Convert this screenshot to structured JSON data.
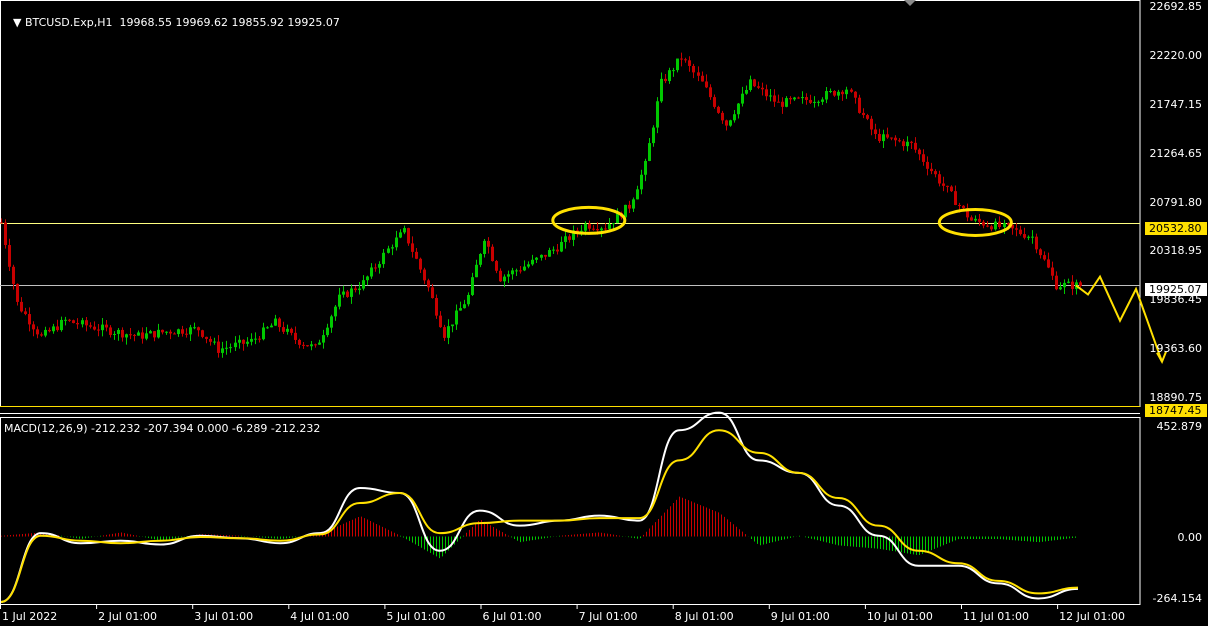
{
  "header": {
    "symbol": "BTCUSD.Exp,H1",
    "ohlc": "19968.55 19969.62 19855.92 19925.07",
    "indicator": "MACD(12,26,9) -212.232 -207.394 0.000 -6.289 -212.232"
  },
  "price_axis": {
    "ticks": [
      "22692.85",
      "22220.00",
      "21747.15",
      "21264.65",
      "20791.80",
      "20318.95",
      "19836.45",
      "19363.60",
      "18890.75"
    ],
    "level_labels": {
      "support_line": "20532.80",
      "current_price": "19925.07",
      "low_line": "18747.45"
    }
  },
  "macd_axis": {
    "ticks": [
      "452.879",
      "0.00",
      "-264.154"
    ]
  },
  "time_axis": {
    "ticks": [
      "1 Jul 2022",
      "2 Jul 01:00",
      "3 Jul 01:00",
      "4 Jul 01:00",
      "5 Jul 01:00",
      "6 Jul 01:00",
      "7 Jul 01:00",
      "8 Jul 01:00",
      "9 Jul 01:00",
      "10 Jul 01:00",
      "11 Jul 01:00",
      "12 Jul 01:00"
    ]
  },
  "colors": {
    "background": "#000000",
    "bull_candle": "#00c800",
    "bear_candle": "#c80000",
    "macd_line": "#ffffff",
    "signal_line": "#ffe000",
    "annotation": "#ffe000",
    "support_line": "#ffff80",
    "current_price_line": "#c0c0c0"
  },
  "chart_data": [
    {
      "type": "candlestick",
      "title": "BTCUSD.Exp,H1",
      "timeframe": "H1",
      "x_range": [
        "1 Jul 2022",
        "12 Jul 2022"
      ],
      "ylim": [
        18747.45,
        22692.85
      ],
      "horizontal_levels": [
        20532.8,
        19925.07,
        18747.45
      ],
      "price_path": [
        {
          "t": "1 Jul 00:00",
          "p": 20540
        },
        {
          "t": "1 Jul 04:00",
          "p": 19750
        },
        {
          "t": "1 Jul 10:00",
          "p": 19420
        },
        {
          "t": "1 Jul 16:00",
          "p": 19580
        },
        {
          "t": "2 Jul 01:00",
          "p": 19500
        },
        {
          "t": "2 Jul 10:00",
          "p": 19430
        },
        {
          "t": "2 Jul 18:00",
          "p": 19480
        },
        {
          "t": "3 Jul 01:00",
          "p": 19500
        },
        {
          "t": "3 Jul 06:00",
          "p": 19300
        },
        {
          "t": "3 Jul 14:00",
          "p": 19380
        },
        {
          "t": "3 Jul 20:00",
          "p": 19560
        },
        {
          "t": "4 Jul 01:00",
          "p": 19400
        },
        {
          "t": "4 Jul 06:00",
          "p": 19310
        },
        {
          "t": "4 Jul 12:00",
          "p": 19800
        },
        {
          "t": "4 Jul 18:00",
          "p": 19950
        },
        {
          "t": "5 Jul 01:00",
          "p": 20330
        },
        {
          "t": "5 Jul 04:00",
          "p": 20450
        },
        {
          "t": "5 Jul 10:00",
          "p": 19900
        },
        {
          "t": "5 Jul 14:00",
          "p": 19450
        },
        {
          "t": "5 Jul 20:00",
          "p": 19820
        },
        {
          "t": "6 Jul 00:00",
          "p": 20400
        },
        {
          "t": "6 Jul 04:00",
          "p": 20000
        },
        {
          "t": "6 Jul 12:00",
          "p": 20150
        },
        {
          "t": "6 Jul 18:00",
          "p": 20300
        },
        {
          "t": "7 Jul 01:00",
          "p": 20520
        },
        {
          "t": "7 Jul 06:00",
          "p": 20500
        },
        {
          "t": "7 Jul 12:00",
          "p": 20700
        },
        {
          "t": "7 Jul 16:00",
          "p": 21100
        },
        {
          "t": "7 Jul 20:00",
          "p": 21900
        },
        {
          "t": "8 Jul 01:00",
          "p": 22150
        },
        {
          "t": "8 Jul 06:00",
          "p": 21900
        },
        {
          "t": "8 Jul 12:00",
          "p": 21500
        },
        {
          "t": "8 Jul 18:00",
          "p": 21900
        },
        {
          "t": "9 Jul 01:00",
          "p": 21700
        },
        {
          "t": "9 Jul 10:00",
          "p": 21750
        },
        {
          "t": "9 Jul 18:00",
          "p": 21850
        },
        {
          "t": "10 Jul 01:00",
          "p": 21380
        },
        {
          "t": "10 Jul 10:00",
          "p": 21300
        },
        {
          "t": "10 Jul 18:00",
          "p": 20900
        },
        {
          "t": "11 Jul 01:00",
          "p": 20560
        },
        {
          "t": "11 Jul 10:00",
          "p": 20480
        },
        {
          "t": "11 Jul 16:00",
          "p": 20400
        },
        {
          "t": "11 Jul 22:00",
          "p": 19930
        },
        {
          "t": "12 Jul 04:00",
          "p": 19925
        }
      ],
      "annotations": [
        {
          "kind": "ellipse",
          "around": "7 Jul 01:00",
          "price": 20560
        },
        {
          "kind": "ellipse",
          "around": "11 Jul 01:00",
          "price": 20540
        },
        {
          "kind": "projected_path",
          "prices": [
            19925,
            19836,
            20010,
            19580,
            19890,
            19180
          ]
        }
      ]
    },
    {
      "type": "line",
      "title": "MACD(12,26,9)",
      "ylim": [
        -264.154,
        452.879
      ],
      "series": [
        {
          "name": "MACD",
          "values": [
            -264,
            10,
            -30,
            -20,
            -35,
            0,
            -10,
            -30,
            10,
            190,
            170,
            -60,
            100,
            40,
            60,
            80,
            60,
            420,
            490,
            300,
            250,
            120,
            0,
            -120,
            -120,
            -190,
            -250,
            -212
          ]
        },
        {
          "name": "Signal",
          "values": [
            -264,
            0,
            -20,
            -30,
            -20,
            -5,
            -10,
            -20,
            5,
            130,
            170,
            10,
            50,
            60,
            60,
            70,
            70,
            300,
            420,
            330,
            250,
            150,
            40,
            -60,
            -110,
            -180,
            -230,
            -207
          ]
        }
      ]
    }
  ]
}
